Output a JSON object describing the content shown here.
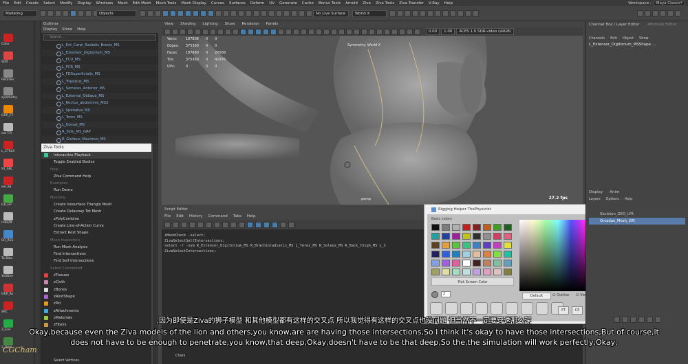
{
  "menubar": {
    "mode": "Modeling",
    "items": [
      "File",
      "Edit",
      "Create",
      "Select",
      "Modify",
      "Display",
      "Windows",
      "Mesh",
      "Edit Mesh",
      "Mesh Tools",
      "Mesh Display",
      "Curves",
      "Surfaces",
      "Deform",
      "UV",
      "Generate",
      "Cache",
      "Bonus Tools",
      "Arnold",
      "Ziva",
      "Ziva Tools",
      "Ziva Transfer",
      "V-Ray",
      "Help"
    ],
    "workspace_label": "Workspace :",
    "workspace": "Maya Classic*"
  },
  "statusline": {
    "objects": "Objects",
    "live": "No Live Surface",
    "symmetry": "World X"
  },
  "outliner": {
    "title": "Outliner",
    "menu": [
      "Display",
      "Show",
      "Help"
    ],
    "search_placeholder": "Search...",
    "rows": [
      "L_Ext_Carpi_Radialis_Brevis_MS",
      "L_Extensor_Digitorium_MS",
      "L_FCU_MS",
      "L_FCR_MS",
      "L_FDSuperficialis_MS",
      "L_Trapizius_MS",
      "L_Serratus_Anterior_MS",
      "L_External_Oblique_MS",
      "L_Rectus_abdominis_MS2",
      "L_Spenatus_MS",
      "L_Teres_MS",
      "L_Dorsal_MS",
      "R_Side_MS_GRP",
      "R_Gluteus_Maximus_MS"
    ]
  },
  "ziva": {
    "title": "Ziva Tools",
    "items": [
      {
        "label": "Interactive Playback",
        "sec": false,
        "hl": true,
        "icon": "play-icon",
        "color": "#3c9"
      },
      {
        "label": "Toggle Enabled Bodies",
        "sec": false
      },
      {
        "label": "Help",
        "sec": true
      },
      {
        "label": "Ziva Command Help",
        "sec": false
      },
      {
        "label": "Examples",
        "sec": true
      },
      {
        "label": "Run Demo",
        "sec": false
      },
      {
        "label": "Meshing",
        "sec": true
      },
      {
        "label": "Create Isosurface Triangle Mesh",
        "sec": false
      },
      {
        "label": "Create Delaunay Tet Mesh",
        "sec": false
      },
      {
        "label": "zPolyCombine",
        "sec": false
      },
      {
        "label": "Create Line-of-Action Curve",
        "sec": false
      },
      {
        "label": "Extract Rest Shape",
        "sec": false
      },
      {
        "label": "Mesh Inspection",
        "sec": true
      },
      {
        "label": "Run Mesh Analysis",
        "sec": false
      },
      {
        "label": "Find Intersections",
        "sec": false
      },
      {
        "label": "Find Self Intersections",
        "sec": false
      },
      {
        "label": "Select Connected",
        "sec": true
      },
      {
        "label": "zTissues",
        "sec": false,
        "icon": "tissue-icon",
        "color": "#d44"
      },
      {
        "label": "zCloth",
        "sec": false,
        "icon": "cloth-icon",
        "color": "#c8a"
      },
      {
        "label": "zBones",
        "sec": false,
        "icon": "bone-icon",
        "color": "#ddd"
      },
      {
        "label": "zRestShape",
        "sec": false,
        "icon": "restshape-icon",
        "color": "#a6c"
      },
      {
        "label": "zTet",
        "sec": false,
        "icon": "tet-icon",
        "color": "#e92"
      },
      {
        "label": "zAttachments",
        "sec": false,
        "icon": "attachment-icon",
        "color": "#4ad"
      },
      {
        "label": "zMaterials",
        "sec": false,
        "icon": "material-icon",
        "color": "#9c4"
      },
      {
        "label": "zFibers",
        "sec": false,
        "icon": "fiber-icon",
        "color": "#c94"
      }
    ]
  },
  "viewport": {
    "menu": [
      "View",
      "Shading",
      "Lighting",
      "Show",
      "Renderer",
      "Panels"
    ],
    "hud": [
      [
        "Verts:",
        "187808",
        "0",
        "0"
      ],
      [
        "Edges:",
        "375360",
        "0",
        "0"
      ],
      [
        "Faces:",
        "187680",
        "0",
        "20568"
      ],
      [
        "Tris:",
        "375360",
        "0",
        "41976"
      ],
      [
        "UVs:",
        "0",
        "0",
        "0"
      ]
    ],
    "symmetry": "Symmetry: World X",
    "camera": "persp",
    "fps": "27.2 fps",
    "exposure": "0.00",
    "gamma": "1.00",
    "colorspace": "ACES 1.0 SDR-video (sRGB)"
  },
  "script": {
    "title": "Script Editor",
    "menu": [
      "File",
      "Edit",
      "History",
      "Command",
      "Tabs",
      "Help"
    ],
    "lines": [
      "zMeshCheck -select;",
      "ZivaSelectSelfIntersections;",
      "select -r -sym R_Extensor_Digitorium_MS R_Brachioradialis_MS L_Teres_MS R_Soleus_MS R_Back_thigh_MS L_S",
      "ZivaSelectIntersections;"
    ]
  },
  "rigging": {
    "title": "Rigging Helper ThePhysicist",
    "basic": "Basic colors",
    "pick": "Pick Screen Color",
    "default": "Default",
    "outline": "Outline",
    "viewport": "Viewport",
    "value": "2",
    "buttons": [
      "FT",
      "CP",
      "LRA"
    ],
    "swatches": [
      "#111111",
      "#7a7a7a",
      "#b0b0b0",
      "#c02020",
      "#802020",
      "#c06020",
      "#40a020",
      "#206020",
      "#20a0a0",
      "#2040a0",
      "#a020a0",
      "#c0c020",
      "#303030",
      "#909090",
      "#d04060",
      "#e06080",
      "#604020",
      "#e0a040",
      "#60c040",
      "#40c080",
      "#4080c0",
      "#6040c0",
      "#c040c0",
      "#e0e040",
      "#202060",
      "#3060e0",
      "#2080c0",
      "#a0d0e0",
      "#e0c0a0",
      "#e08040",
      "#80e040",
      "#20c0a0",
      "#80a0e0",
      "#a060e0",
      "#e060a0",
      "#ffffff",
      "#402020",
      "#c08060",
      "#80c0a0",
      "#60a0c0",
      "#a0a060",
      "#e0e0a0",
      "#a0e0c0",
      "#c0e0e0",
      "#c0a0e0",
      "#e0a0c0",
      "#e0c0c0",
      "#808040"
    ]
  },
  "channelbox": {
    "title": "Channel Box / Layer Editor",
    "tab2": "Attribute Editor",
    "menu": [
      "Channels",
      "Edit",
      "Object",
      "Show"
    ],
    "selected": "L_Extensor_Digitorium_MSShape ...",
    "layer_tabs": [
      "Display",
      "Anim"
    ],
    "layer_menu": [
      "Layers",
      "Options",
      "Help"
    ],
    "layers": [
      "Skeleton_GEO_LYR",
      "Orcadae_Mesh_LYR"
    ]
  },
  "subtitles": {
    "cn": ",因为即使是Ziva的狮子模型 和其他模型都有这样的交叉点 所以我觉得有这样的交叉点也没问题 但当然不一定要穿透那么深",
    "en": "Okay,because even the Ziva models of the lion and others,you know,are are having those intersections,So I think it's okay to have those intersections,But of course,it does not have to be enough to penetrate,you know,that deep,Okay,doesn't have to be that deep,So the,the simulation will work perfectly,Okay,"
  },
  "shelf": {
    "labels": [
      "Color",
      "SDR",
      "ReOrder",
      "symmetry",
      "GRP_CT",
      "cnt T.R",
      "L_CTRLS",
      "ST_SPL",
      "sel_SS",
      "GP_GP",
      "Hide/N",
      "CR_RES",
      "Ta Bala",
      "YetiGen",
      "GRP_Re",
      "SRC",
      "2_Env",
      "2_Defo"
    ],
    "colors": [
      "#c22",
      "#d44",
      "#888",
      "#888",
      "#e80",
      "#bbb",
      "#c22",
      "#e44",
      "#c22",
      "#4a4",
      "#bbb",
      "#48c",
      "#bbb",
      "#bbb",
      "#c33",
      "#c22",
      "#2a4",
      "#484"
    ]
  },
  "bottom": {
    "items": [
      "Chars",
      "Select Vertices"
    ]
  },
  "watermark": "CGCham"
}
